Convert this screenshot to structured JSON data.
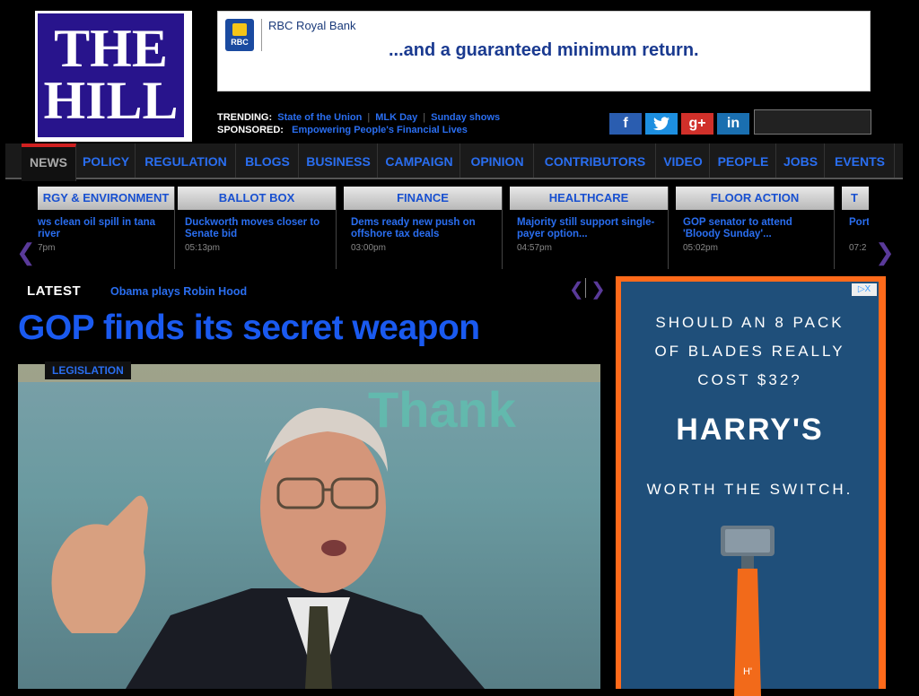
{
  "logo": {
    "line1": "THE",
    "line2": "HILL"
  },
  "banner": {
    "bank_mark": "RBC",
    "bank_name": "RBC Royal Bank",
    "tagline": "...and a guaranteed minimum return."
  },
  "trending": {
    "label": "TRENDING:",
    "items": [
      "State of the Union",
      "MLK Day",
      "Sunday shows"
    ],
    "sponsored_label": "SPONSORED:",
    "sponsored_item": "Empowering People's Financial Lives"
  },
  "social": {
    "facebook": "f",
    "twitter": "t",
    "google": "g+",
    "linkedin": "in"
  },
  "nav": [
    "NEWS",
    "POLICY",
    "REGULATION",
    "BLOGS",
    "BUSINESS",
    "CAMPAIGN",
    "OPINION",
    "CONTRIBUTORS",
    "VIDEO",
    "PEOPLE",
    "JOBS",
    "EVENTS"
  ],
  "topics": [
    {
      "head": "RGY & ENVIRONMENT",
      "title": "ws clean oil spill in tana river",
      "time": "7pm"
    },
    {
      "head": "BALLOT BOX",
      "title": "Duckworth moves closer to Senate bid",
      "time": "05:13pm"
    },
    {
      "head": "FINANCE",
      "title": "Dems ready new push on offshore tax deals",
      "time": "03:00pm"
    },
    {
      "head": "HEALTHCARE",
      "title": "Majority still support single-payer option...",
      "time": "04:57pm"
    },
    {
      "head": "FLOOR ACTION",
      "title": "GOP senator to attend 'Bloody Sunday'...",
      "time": "05:02pm"
    },
    {
      "head": "T",
      "title": "Port",
      "time": "07:2"
    }
  ],
  "latest": {
    "label": "LATEST",
    "link": "Obama plays Robin Hood"
  },
  "headline": "GOP finds its secret weapon",
  "photo_tag": "LEGISLATION",
  "ad": {
    "question_1": "SHOULD AN 8 PACK",
    "question_2": "OF BLADES REALLY",
    "question_3": "COST $32?",
    "brand": "HARRY'S",
    "tagline": "WORTH THE SWITCH.",
    "handle_mark": "H'",
    "choices_label": "▷X"
  },
  "colors": {
    "link": "#2a6ef0",
    "logo_bg": "#28148c",
    "ad_bg": "#1f4f7a",
    "ad_frame": "#ff6a1a",
    "nav_active_bar": "#d02020"
  }
}
